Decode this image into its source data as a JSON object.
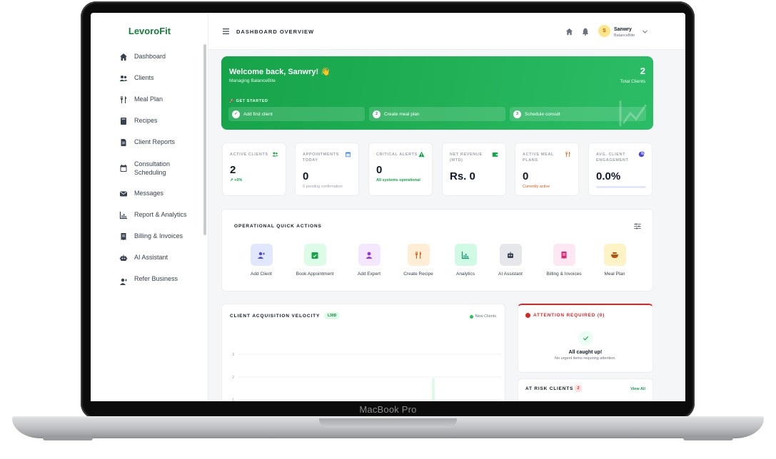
{
  "device": {
    "label": "MacBook Pro"
  },
  "brand": "LevoroFit",
  "sidebar": {
    "items": [
      {
        "label": "Dashboard",
        "icon": "home-icon"
      },
      {
        "label": "Clients",
        "icon": "users-icon"
      },
      {
        "label": "Meal Plan",
        "icon": "utensils-icon"
      },
      {
        "label": "Recipes",
        "icon": "book-icon"
      },
      {
        "label": "Client Reports",
        "icon": "file-icon"
      },
      {
        "label": "Consultation Scheduling",
        "icon": "calendar-icon"
      },
      {
        "label": "Messages",
        "icon": "envelope-icon"
      },
      {
        "label": "Report & Analytics",
        "icon": "chart-icon"
      },
      {
        "label": "Billing & Invoices",
        "icon": "invoice-icon"
      },
      {
        "label": "AI Assistant",
        "icon": "robot-icon"
      },
      {
        "label": "Refer Business",
        "icon": "user-plus-icon"
      }
    ]
  },
  "header": {
    "title": "DASHBOARD OVERVIEW",
    "user": {
      "initial": "S",
      "name": "Sanwry",
      "org": "BalanceBite"
    }
  },
  "welcome": {
    "title": "Welcome back, Sanwry! 👋",
    "subtitle": "Managing BalanceBite",
    "count": "2",
    "count_label": "Total Clients",
    "get_started": "🚀 GET STARTED",
    "steps": [
      {
        "marker": "✓",
        "label": "Add first client"
      },
      {
        "marker": "2",
        "label": "Create meal plan"
      },
      {
        "marker": "3",
        "label": "Schedule consult"
      }
    ]
  },
  "stats": [
    {
      "label": "ACTIVE CLIENTS",
      "value": "2",
      "note": "↗ +0%",
      "icon": "users-icon",
      "color": "#16a34a"
    },
    {
      "label": "APPOINTMENTS TODAY",
      "value": "0",
      "note": "0 pending confirmation",
      "icon": "calendar-icon",
      "color": "#3b82f6"
    },
    {
      "label": "CRITICAL ALERTS",
      "value": "0",
      "note": "All systems operational",
      "icon": "warning-icon",
      "color": "#16a34a"
    },
    {
      "label": "NET REVENUE (MTD)",
      "value": "Rs. 0",
      "note": "",
      "icon": "wallet-icon",
      "color": "#16a34a"
    },
    {
      "label": "ACTIVE MEAL PLANS",
      "value": "0",
      "note": "Currently active",
      "icon": "utensils-icon",
      "color": "#ea580c"
    },
    {
      "label": "AVG. CLIENT ENGAGEMENT",
      "value": "0.0%",
      "note": "",
      "icon": "pie-icon",
      "color": "#4f46e5",
      "progress": 0
    }
  ],
  "quick_actions": {
    "title": "OPERATIONAL QUICK ACTIONS",
    "items": [
      {
        "label": "Add Client",
        "icon": "user-plus-icon",
        "bg": "#e0e7ff",
        "fg": "#4f46e5"
      },
      {
        "label": "Book Appointment",
        "icon": "calendar-check-icon",
        "bg": "#dcfce7",
        "fg": "#16a34a"
      },
      {
        "label": "Add Expert",
        "icon": "user-icon",
        "bg": "#f3e8ff",
        "fg": "#9333ea"
      },
      {
        "label": "Create Recipe",
        "icon": "utensils-icon",
        "bg": "#ffedd5",
        "fg": "#ea580c"
      },
      {
        "label": "Analytics",
        "icon": "chart-icon",
        "bg": "#d1fae5",
        "fg": "#059669"
      },
      {
        "label": "AI Assistant",
        "icon": "robot-icon",
        "bg": "#e5e7eb",
        "fg": "#374151"
      },
      {
        "label": "Billing & Invoices",
        "icon": "invoice-icon",
        "bg": "#fce7f3",
        "fg": "#db2777"
      },
      {
        "label": "Meal Plan",
        "icon": "bowl-icon",
        "bg": "#fef3c7",
        "fg": "#b45309"
      }
    ]
  },
  "chart_data": {
    "type": "line",
    "title": "CLIENT ACQUISITION VELOCITY",
    "badge": "L30D",
    "series": [
      {
        "name": "New Clients",
        "color": "#22c55e"
      }
    ],
    "y_ticks": [
      "3",
      "2",
      "1"
    ],
    "ylim": [
      0,
      3
    ],
    "grid": true
  },
  "attention": {
    "title": "ATTENTION REQUIRED (0)",
    "heading": "All caught up!",
    "sub": "No urgent items requiring attention."
  },
  "at_risk": {
    "title": "AT RISK CLIENTS",
    "count": "2",
    "link": "View All"
  }
}
